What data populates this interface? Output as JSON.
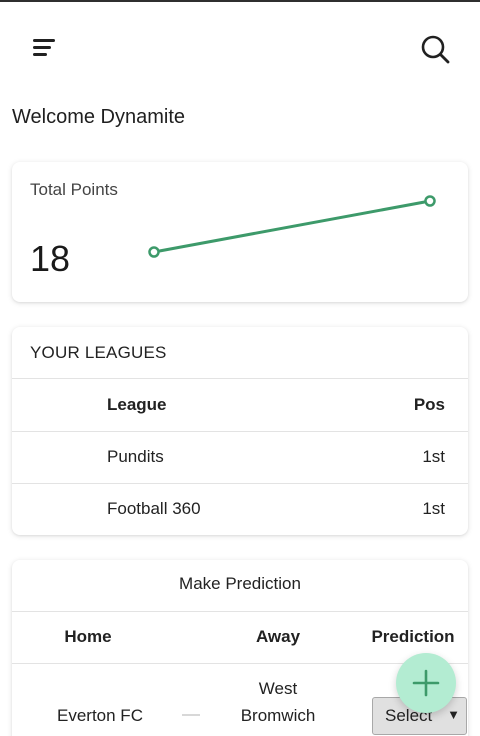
{
  "welcome": "Welcome Dynamite",
  "points": {
    "label": "Total Points",
    "value": "18"
  },
  "leagues": {
    "title": "YOUR LEAGUES",
    "headers": {
      "league": "League",
      "pos": "Pos"
    },
    "rows": [
      {
        "league": "Pundits",
        "pos": "1st"
      },
      {
        "league": "Football 360",
        "pos": "1st"
      }
    ]
  },
  "prediction": {
    "title": "Make Prediction",
    "headers": {
      "home": "Home",
      "away": "Away",
      "prediction": "Prediction"
    },
    "match": {
      "home": "Everton FC",
      "away_line1": "West",
      "away_line2": "Bromwich",
      "select_label": "Select"
    }
  },
  "icons": {
    "menu": "menu-icon",
    "search": "search-icon",
    "add": "plus-icon",
    "dropdown": "caret-down-icon"
  },
  "colors": {
    "accent": "#3d9a6a",
    "fab": "#b3ecd2"
  }
}
